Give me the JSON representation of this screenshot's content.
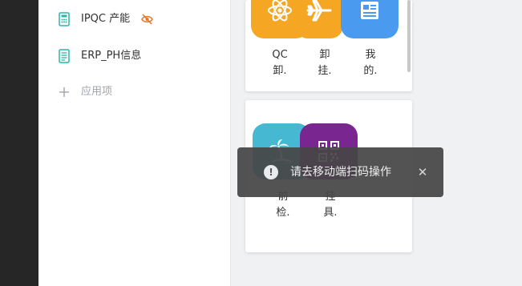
{
  "sidebar": {
    "items": [
      {
        "label": "IPQC 产能",
        "icon": "calculator-icon",
        "hidden_badge_icon": "eye-off-icon"
      },
      {
        "label": "ERP_PH信息",
        "icon": "document-list-icon"
      },
      {
        "label": "应用项",
        "icon": "plus-icon"
      }
    ]
  },
  "cards": {
    "top": {
      "tiles": [
        {
          "label": "QC\n卸.",
          "icon": "atom-icon",
          "color": "#f5a623"
        },
        {
          "label": "卸\n挂.",
          "icon": "airplane-icon",
          "color": "#f5a623"
        },
        {
          "label": "我\n的.",
          "icon": "newspaper-icon",
          "color": "#4a9bf0"
        }
      ]
    },
    "bottom": {
      "tiles": [
        {
          "label": "前\n检.",
          "icon": "palm-tree-icon",
          "color": "#47b8d2"
        },
        {
          "label": "挂\n具.",
          "icon": "qr-code-icon",
          "color": "#7a2690"
        }
      ]
    }
  },
  "toast": {
    "message": "请去移动端扫码操作",
    "info_icon": "info-icon",
    "close_symbol": "✕",
    "info_symbol": "!"
  },
  "colors": {
    "accent_orange": "#f5a623",
    "accent_blue": "#4a9bf0",
    "eye_icon": "#e07a2e",
    "sidebar_icon": "#2bb5a8"
  }
}
